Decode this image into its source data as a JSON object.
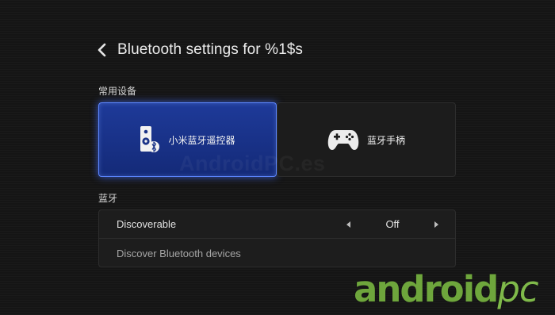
{
  "header": {
    "title": "Bluetooth settings for %1$s",
    "back_icon": "chevron-left-icon"
  },
  "sections": {
    "devices_label": "常用设备",
    "bluetooth_label": "蓝牙"
  },
  "device_cards": [
    {
      "label": "小米蓝牙遥控器",
      "icon": "bluetooth-remote-icon",
      "selected": true
    },
    {
      "label": "蓝牙手柄",
      "icon": "gamepad-icon",
      "selected": false
    }
  ],
  "bluetooth_list": {
    "discoverable": {
      "label": "Discoverable",
      "value": "Off"
    },
    "discover": {
      "label": "Discover Bluetooth devices"
    }
  },
  "watermark": "AndroidPC.es",
  "logo": {
    "text": "android",
    "suffix": "pc"
  },
  "colors": {
    "background": "#151515",
    "selected_card": "#1a3388",
    "selected_border": "#5c86ff",
    "logo_green": "#6ea63c"
  }
}
